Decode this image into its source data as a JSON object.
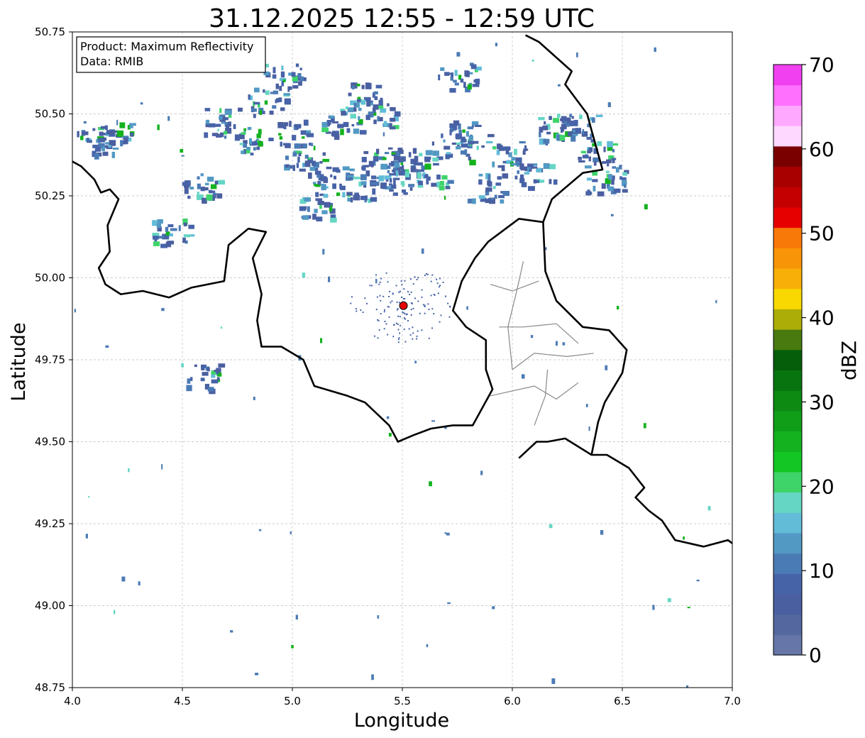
{
  "title": "31.12.2025 12:55 - 12:59 UTC",
  "info_box": {
    "product_line": "Product: Maximum Reflectivity",
    "data_line": "Data: RMIB"
  },
  "axes": {
    "xlabel": "Longitude",
    "ylabel": "Latitude",
    "xlim": [
      4.0,
      7.0
    ],
    "ylim": [
      48.75,
      50.75
    ],
    "x_ticks": [
      "4.0",
      "4.5",
      "5.0",
      "5.5",
      "6.0",
      "6.5",
      "7.0"
    ],
    "y_ticks": [
      "48.75",
      "49.00",
      "49.25",
      "49.50",
      "49.75",
      "50.00",
      "50.25",
      "50.50",
      "50.75"
    ],
    "grid": true
  },
  "colorbar": {
    "label": "dBZ",
    "range": [
      0,
      70
    ],
    "ticks": [
      "0",
      "10",
      "20",
      "30",
      "40",
      "50",
      "60",
      "70"
    ],
    "colors": [
      "#6676a8",
      "#55679f",
      "#4a5fa0",
      "#4763a8",
      "#4b7bb5",
      "#5299c4",
      "#62bcd8",
      "#66d6c4",
      "#3ed46a",
      "#14c624",
      "#14b21e",
      "#109e18",
      "#0c8a12",
      "#087410",
      "#055e0a",
      "#487a10",
      "#adad08",
      "#f8d800",
      "#f8b008",
      "#f89408",
      "#f87808",
      "#e60000",
      "#c40000",
      "#a80000",
      "#7a0000",
      "#ffd8ff",
      "#ffa8ff",
      "#ff70ff",
      "#f040f0"
    ]
  },
  "radar_site": {
    "lon": 5.505,
    "lat": 49.915,
    "color": "#e60000"
  },
  "map_lines": {
    "belgium_border": [
      [
        4.0,
        50.355
      ],
      [
        4.04,
        50.34
      ],
      [
        4.1,
        50.3
      ],
      [
        4.13,
        50.26
      ],
      [
        4.17,
        50.27
      ],
      [
        4.21,
        50.24
      ],
      [
        4.16,
        50.16
      ],
      [
        4.17,
        50.08
      ],
      [
        4.12,
        50.03
      ],
      [
        4.15,
        49.98
      ],
      [
        4.22,
        49.95
      ],
      [
        4.32,
        49.96
      ],
      [
        4.44,
        49.94
      ],
      [
        4.54,
        49.97
      ],
      [
        4.69,
        49.99
      ],
      [
        4.71,
        50.1
      ],
      [
        4.8,
        50.15
      ],
      [
        4.88,
        50.14
      ],
      [
        4.82,
        50.06
      ],
      [
        4.86,
        49.95
      ],
      [
        4.84,
        49.87
      ],
      [
        4.86,
        49.79
      ],
      [
        4.95,
        49.79
      ],
      [
        5.05,
        49.75
      ],
      [
        5.1,
        49.67
      ],
      [
        5.25,
        49.64
      ],
      [
        5.33,
        49.62
      ],
      [
        5.44,
        49.55
      ],
      [
        5.48,
        49.5
      ],
      [
        5.55,
        49.52
      ],
      [
        5.63,
        49.54
      ],
      [
        5.73,
        49.55
      ],
      [
        5.82,
        49.55
      ],
      [
        5.91,
        49.66
      ],
      [
        5.88,
        49.72
      ],
      [
        5.88,
        49.81
      ],
      [
        5.79,
        49.85
      ],
      [
        5.73,
        49.9
      ],
      [
        5.77,
        49.99
      ],
      [
        5.83,
        50.06
      ],
      [
        5.89,
        50.11
      ],
      [
        6.03,
        50.18
      ],
      [
        6.14,
        50.17
      ],
      [
        6.18,
        50.24
      ],
      [
        6.32,
        50.32
      ],
      [
        6.41,
        50.33
      ],
      [
        6.36,
        50.45
      ],
      [
        6.34,
        50.5
      ],
      [
        6.24,
        50.59
      ],
      [
        6.27,
        50.63
      ],
      [
        6.12,
        50.72
      ],
      [
        6.06,
        50.74
      ]
    ],
    "france_germany_border": [
      [
        6.03,
        49.45
      ],
      [
        6.11,
        49.5
      ],
      [
        6.16,
        49.5
      ],
      [
        6.24,
        49.51
      ],
      [
        6.36,
        49.46
      ],
      [
        6.43,
        49.46
      ],
      [
        6.53,
        49.42
      ],
      [
        6.6,
        49.36
      ],
      [
        6.56,
        49.33
      ],
      [
        6.62,
        49.29
      ],
      [
        6.68,
        49.26
      ],
      [
        6.74,
        49.2
      ],
      [
        6.87,
        49.18
      ],
      [
        6.98,
        49.2
      ],
      [
        7.0,
        49.19
      ]
    ],
    "lux_germany_border": [
      [
        6.36,
        49.46
      ],
      [
        6.39,
        49.56
      ],
      [
        6.42,
        49.62
      ],
      [
        6.5,
        49.71
      ],
      [
        6.52,
        49.78
      ],
      [
        6.44,
        49.84
      ],
      [
        6.32,
        49.85
      ],
      [
        6.2,
        49.93
      ],
      [
        6.15,
        50.02
      ],
      [
        6.14,
        50.17
      ]
    ],
    "lux_cantons": [
      [
        [
          5.9,
          49.64
        ],
        [
          6.1,
          49.67
        ],
        [
          6.2,
          49.63
        ],
        [
          6.3,
          49.68
        ]
      ],
      [
        [
          6.0,
          49.72
        ],
        [
          6.1,
          49.77
        ],
        [
          6.25,
          49.76
        ],
        [
          6.37,
          49.77
        ]
      ],
      [
        [
          5.94,
          49.85
        ],
        [
          6.05,
          49.85
        ],
        [
          6.2,
          49.86
        ],
        [
          6.3,
          49.8
        ]
      ],
      [
        [
          5.9,
          49.98
        ],
        [
          6.0,
          49.96
        ],
        [
          6.12,
          49.99
        ]
      ],
      [
        [
          6.0,
          49.72
        ],
        [
          5.98,
          49.85
        ],
        [
          6.02,
          49.96
        ],
        [
          6.05,
          50.05
        ]
      ],
      [
        [
          6.1,
          49.55
        ],
        [
          6.15,
          49.64
        ],
        [
          6.16,
          49.72
        ]
      ]
    ]
  },
  "echo_seeds": [
    [
      4.1,
      50.42
    ],
    [
      4.18,
      50.44
    ],
    [
      4.45,
      50.14
    ],
    [
      4.58,
      50.28
    ],
    [
      4.68,
      50.48
    ],
    [
      4.82,
      50.42
    ],
    [
      4.88,
      50.54
    ],
    [
      4.95,
      50.62
    ],
    [
      5.02,
      50.45
    ],
    [
      5.05,
      50.35
    ],
    [
      5.12,
      50.22
    ],
    [
      5.18,
      50.3
    ],
    [
      5.22,
      50.48
    ],
    [
      5.32,
      50.56
    ],
    [
      5.38,
      50.5
    ],
    [
      5.4,
      50.36
    ],
    [
      5.32,
      50.28
    ],
    [
      5.45,
      50.3
    ],
    [
      5.52,
      50.36
    ],
    [
      5.62,
      50.32
    ],
    [
      5.72,
      50.4
    ],
    [
      5.8,
      50.44
    ],
    [
      5.88,
      50.28
    ],
    [
      5.98,
      50.38
    ],
    [
      6.1,
      50.32
    ],
    [
      6.2,
      50.46
    ],
    [
      6.3,
      50.46
    ],
    [
      6.38,
      50.38
    ],
    [
      4.58,
      49.7
    ],
    [
      5.75,
      50.62
    ],
    [
      6.42,
      50.3
    ]
  ]
}
